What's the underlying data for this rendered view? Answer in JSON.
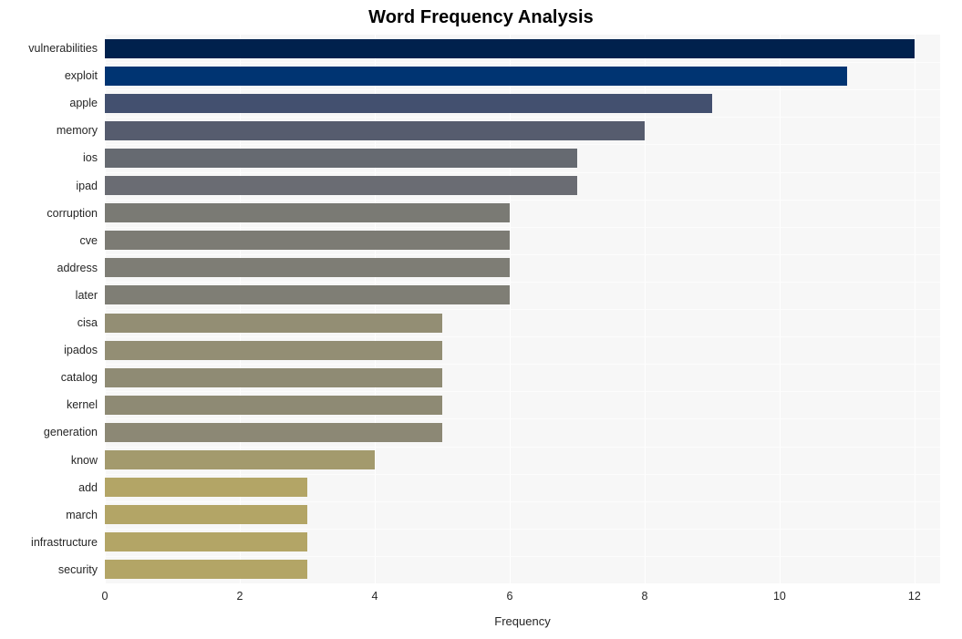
{
  "chart_data": {
    "type": "bar",
    "orientation": "horizontal",
    "title": "Word Frequency Analysis",
    "xlabel": "Frequency",
    "ylabel": "",
    "xlim": [
      0,
      12.38
    ],
    "xticks": [
      0,
      2,
      4,
      6,
      8,
      10,
      12
    ],
    "xtick_labels": [
      "0",
      "2",
      "4",
      "6",
      "8",
      "10",
      "12"
    ],
    "grid": true,
    "legend": null,
    "categories": [
      "vulnerabilities",
      "exploit",
      "apple",
      "memory",
      "ios",
      "ipad",
      "corruption",
      "cve",
      "address",
      "later",
      "cisa",
      "ipados",
      "catalog",
      "kernel",
      "generation",
      "know",
      "add",
      "march",
      "infrastructure",
      "security"
    ],
    "values": [
      12,
      11,
      9,
      8,
      7,
      7,
      6,
      6,
      6,
      6,
      5,
      5,
      5,
      5,
      5,
      4,
      3,
      3,
      3,
      3
    ],
    "colors": [
      "#00214d",
      "#003472",
      "#43506f",
      "#565c6e",
      "#666a71",
      "#6a6c73",
      "#7a7a74",
      "#7c7b74",
      "#7e7d75",
      "#7f7e75",
      "#938e74",
      "#938e74",
      "#8f8b74",
      "#8e8a74",
      "#8c8875",
      "#a39a6d",
      "#b3a566",
      "#b3a566",
      "#b3a566",
      "#b3a566"
    ],
    "plot_background": "#f7f7f7",
    "gridline_color": "#ffffff",
    "figure_background": "#ffffff",
    "colormap": "cividis"
  }
}
